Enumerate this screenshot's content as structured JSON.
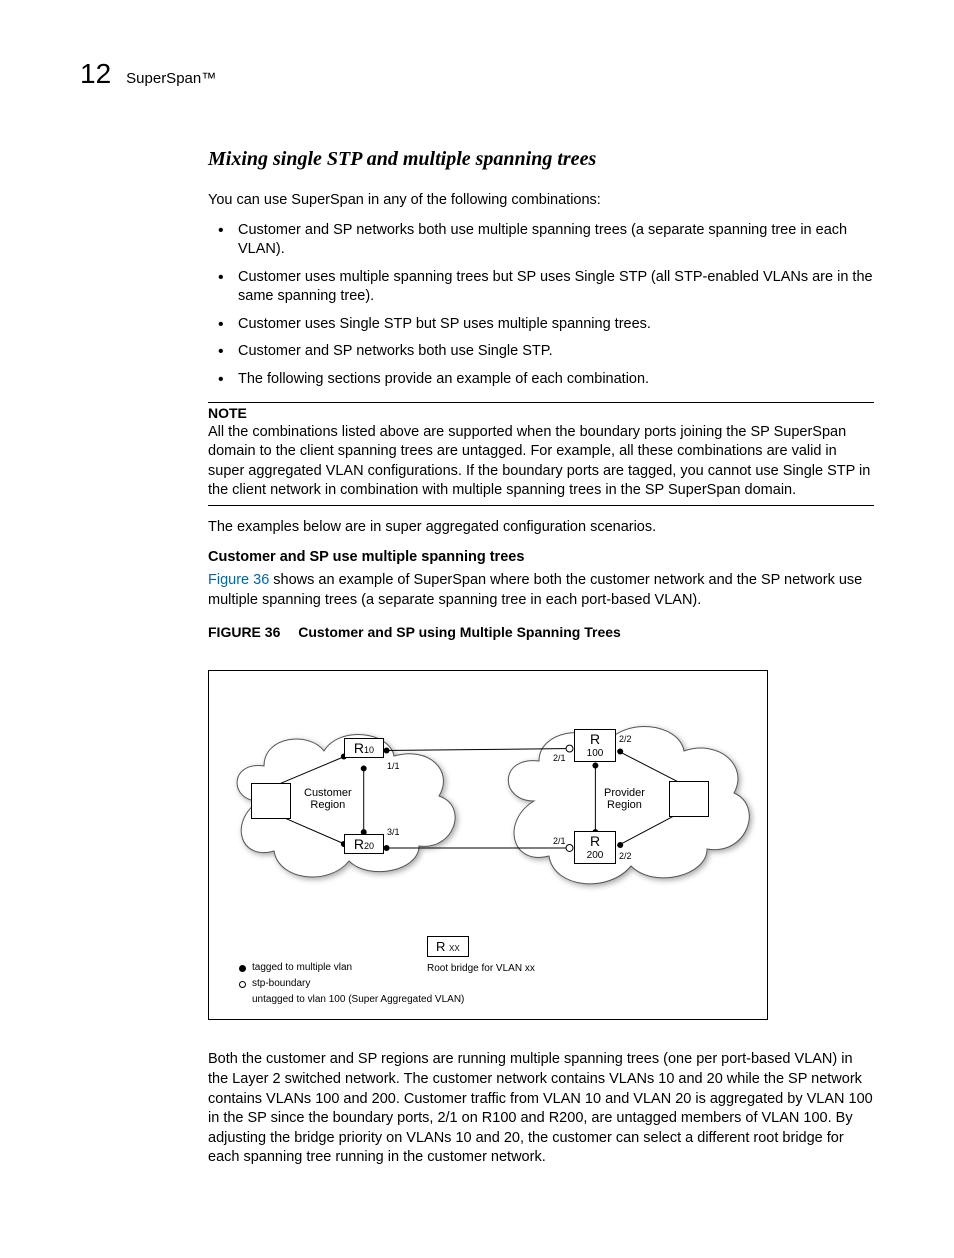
{
  "header": {
    "chapter_number": "12",
    "chapter_title": "SuperSpan™"
  },
  "section_title": "Mixing single STP and multiple spanning trees",
  "intro": "You can use SuperSpan in any of the following combinations:",
  "bullets": [
    "Customer and SP networks both use multiple spanning trees (a separate spanning tree in each VLAN).",
    "Customer uses multiple spanning trees but SP uses Single STP (all STP-enabled VLANs are in the same spanning tree).",
    "Customer uses Single STP but SP uses multiple spanning trees.",
    "Customer and SP networks both use Single STP.",
    "The following sections provide an example of each combination."
  ],
  "note": {
    "label": "NOTE",
    "text": "All the combinations listed above are supported when the boundary ports joining the SP SuperSpan domain to the client spanning trees are untagged.  For example, all these combinations are valid in super aggregated VLAN configurations.  If the boundary ports are tagged, you cannot use Single STP in the client network in combination with multiple spanning trees in the SP SuperSpan domain."
  },
  "after_note": "The examples below are in super aggregated configuration scenarios.",
  "subhead1": "Customer and SP use multiple spanning trees",
  "figref_text_pre": "Figure 36",
  "figref_text_post": " shows an example of SuperSpan where both the customer network and the SP network use multiple spanning trees (a separate spanning tree in each port-based VLAN).",
  "figure": {
    "label": "FIGURE 36",
    "title": "Customer and SP using Multiple Spanning Trees"
  },
  "diagram": {
    "customer_region": "Customer\nRegion",
    "provider_region": "Provider\nRegion",
    "r10": {
      "r": "R",
      "sub": "10"
    },
    "r20": {
      "r": "R",
      "sub": "20"
    },
    "r100": {
      "r": "R",
      "sub": "100"
    },
    "r200": {
      "r": "R",
      "sub": "200"
    },
    "ports": {
      "p11": "1/1",
      "p31": "3/1",
      "p21a": "2/1",
      "p21b": "2/1",
      "p22a": "2/2",
      "p22b": "2/2"
    },
    "legend": {
      "tagged": "tagged to multiple vlan",
      "boundary": "stp-boundary",
      "untagged": "untagged to vlan 100 (Super Aggregated VLAN)",
      "rxx": "R",
      "rxx_sub": "XX",
      "rxx_desc": "Root bridge for VLAN xx"
    }
  },
  "closing": "Both the customer and SP regions are running multiple spanning trees (one per port-based VLAN) in the Layer 2 switched network.  The customer network contains VLANs 10 and 20 while the SP network contains VLANs 100 and 200.  Customer traffic from VLAN 10 and VLAN 20 is aggregated by VLAN 100 in the SP since the boundary ports, 2/1 on R100 and R200, are untagged members of VLAN 100.  By adjusting the bridge priority on VLANs 10 and 20, the customer can select a different root bridge for each spanning tree running in the customer network."
}
